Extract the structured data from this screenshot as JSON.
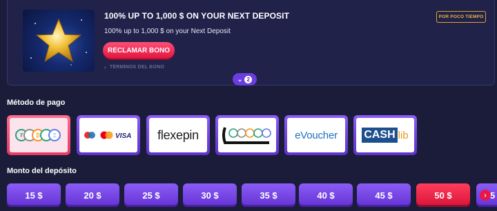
{
  "bonus": {
    "title": "100% UP TO 1,000 $ ON YOUR NEXT DEPOSIT",
    "subtitle": "100% up to 1,000 $ on your Next Deposit",
    "claim_label": "RECLAMAR BONO",
    "terms_label": "TÉRMINOS DEL BONO",
    "limited_badge": "POR POCO TIEMPO",
    "more_count": "2",
    "image_icon": "gold-star-icon"
  },
  "payment": {
    "title": "Método de pago",
    "methods": [
      {
        "name": "crypto",
        "icon": "crypto-coins-logo",
        "selected": true
      },
      {
        "name": "cards",
        "icon": "card-brands-logo",
        "labels": [
          "Maestro",
          "VISA"
        ]
      },
      {
        "name": "flexepin",
        "label": "flexepin"
      },
      {
        "name": "crypto-alt",
        "icon": "crypto-coins-logo-alt"
      },
      {
        "name": "evoucher",
        "label": "eVoucher"
      },
      {
        "name": "cashlib",
        "label": "CASHlib",
        "parts": [
          "CASH",
          "lib"
        ]
      }
    ]
  },
  "amounts": {
    "title": "Monto del depósito",
    "options": [
      "15 $",
      "20 $",
      "25 $",
      "30 $",
      "35 $",
      "40 $",
      "45 $",
      "50 $"
    ],
    "selected": "50 $",
    "partial_next": "5"
  },
  "colors": {
    "background": "#1b1c3a",
    "accent_purple": "#7a4ae6",
    "accent_red": "#e8174a",
    "badge_gold": "#f0b43a"
  }
}
